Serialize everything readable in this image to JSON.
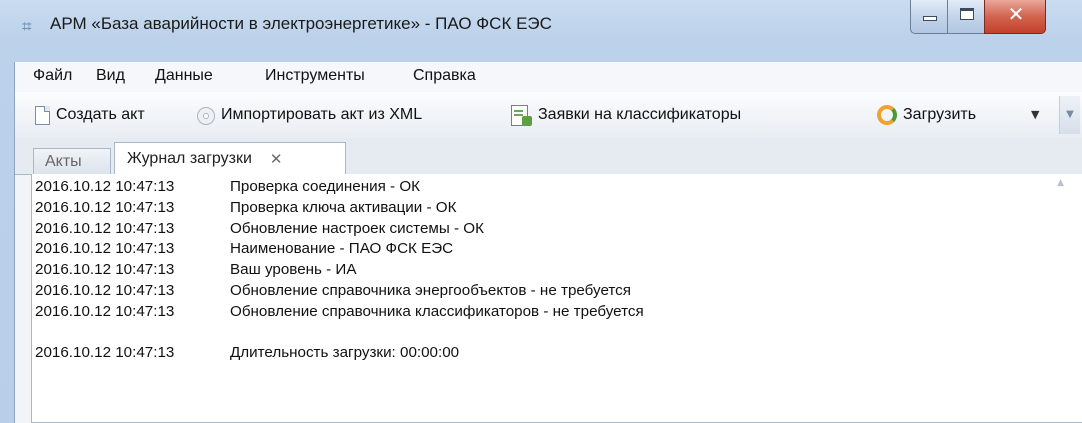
{
  "window": {
    "title": "АРМ «База аварийности в электроэнергетике» - ПАО ФСК ЕЭС",
    "app_icon": "hash-icon",
    "controls": {
      "minimize": "minimize-icon",
      "maximize": "maximize-icon",
      "close": "✕"
    }
  },
  "menu": {
    "items": [
      "Файл",
      "Вид",
      "Данные",
      "Инструменты",
      "Справка"
    ]
  },
  "toolbar": {
    "create_act": "Создать акт",
    "import_xml": "Импортировать акт из XML",
    "classifier_requests": "Заявки на классификаторы",
    "load": "Загрузить",
    "load_dropdown": "▼",
    "overflow": "▼"
  },
  "tabs": {
    "acts": "Акты",
    "log": "Журнал загрузки",
    "close_glyph": "✕"
  },
  "log": {
    "entries": [
      {
        "time": "2016.10.12 10:47:13",
        "message": "Проверка соединения - ОК"
      },
      {
        "time": "2016.10.12 10:47:13",
        "message": "Проверка ключа активации - ОК"
      },
      {
        "time": "2016.10.12 10:47:13",
        "message": "Обновление настроек системы - ОК"
      },
      {
        "time": "2016.10.12 10:47:13",
        "message": "Наименование - ПАО ФСК ЕЭС"
      },
      {
        "time": "2016.10.12 10:47:13",
        "message": "Ваш уровень - ИА"
      },
      {
        "time": "2016.10.12 10:47:13",
        "message": "Обновление справочника энергообъектов - не требуется"
      },
      {
        "time": "2016.10.12 10:47:13",
        "message": "Обновление справочника классификаторов - не требуется"
      }
    ],
    "summary": {
      "time": "2016.10.12 10:47:13",
      "message": "Длительность загрузки: 00:00:00"
    },
    "scroll_up": "▲"
  },
  "colors": {
    "title_bar": "#bcd1ea",
    "close_button": "#c2402a",
    "tab_active": "#ffffff",
    "log_background": "#ffffff"
  }
}
